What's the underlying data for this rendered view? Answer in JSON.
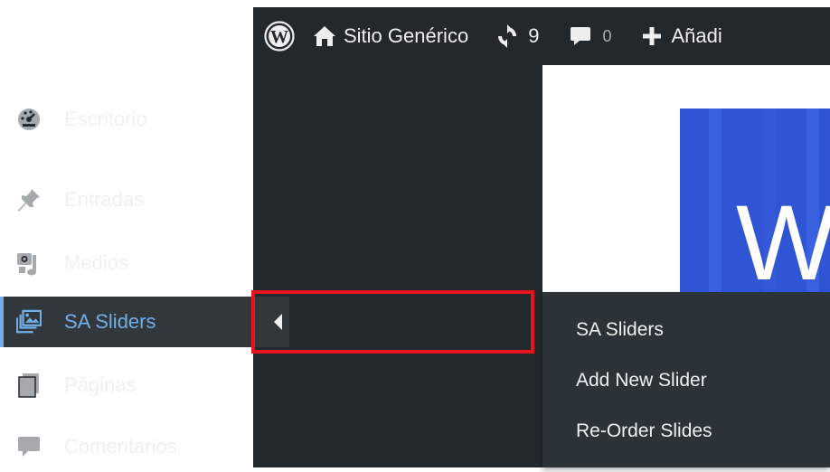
{
  "admin_bar": {
    "wp_logo_icon": "wordpress-logo-icon",
    "site_name": "Sitio Genérico",
    "updates_count": "9",
    "comments_count": "0",
    "new_label": "Añadi"
  },
  "sidebar": {
    "items": [
      {
        "label": "Escritorio",
        "icon": "dashboard-icon"
      },
      {
        "label": "Entradas",
        "icon": "pin-icon"
      },
      {
        "label": "Medios",
        "icon": "media-icon"
      },
      {
        "label": "SA Sliders",
        "icon": "slider-images-icon",
        "active": true
      },
      {
        "label": "Páginas",
        "icon": "page-icon"
      },
      {
        "label": "Comentarios",
        "icon": "comment-icon"
      }
    ]
  },
  "submenu": {
    "items": [
      {
        "label": "SA Sliders"
      },
      {
        "label": "Add New Slider"
      },
      {
        "label": "Re-Order Slides"
      }
    ]
  },
  "banner": {
    "text": "W"
  },
  "colors": {
    "admin_bg": "#23282d",
    "active_blue": "#72aee6",
    "highlight_red": "#e8131c",
    "banner_blue": "#2f55d4"
  }
}
